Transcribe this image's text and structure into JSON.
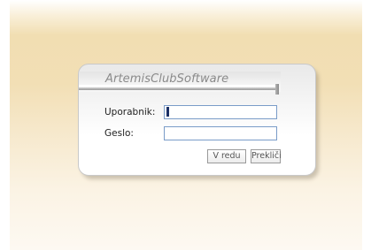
{
  "login": {
    "app_title": "ArtemisClubSoftware",
    "username_label": "Uporabnik:",
    "username_value": "",
    "password_label": "Geslo:",
    "password_value": "",
    "ok_label": "V redu",
    "cancel_label": "Prekliči"
  },
  "colors": {
    "background_accent": "#f1deb2",
    "field_border": "#7a9cc8",
    "title_text": "#8a8a8a"
  }
}
